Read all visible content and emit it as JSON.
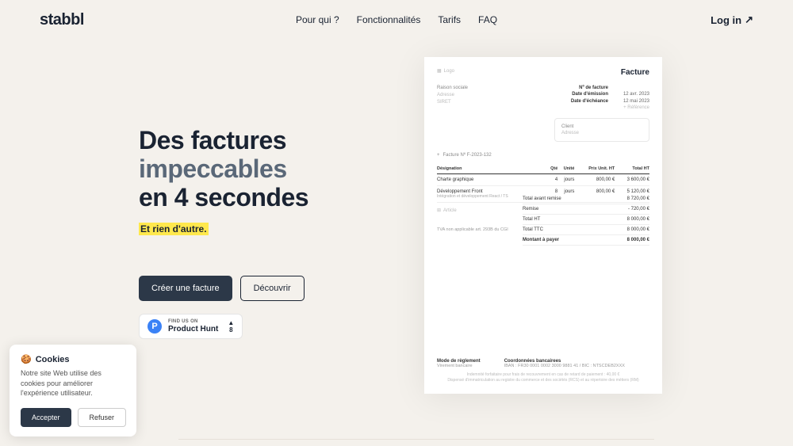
{
  "header": {
    "logo": "stabbl",
    "nav": [
      "Pour qui ?",
      "Fonctionnalités",
      "Tarifs",
      "FAQ"
    ],
    "login": "Log in",
    "login_icon": "↗"
  },
  "hero": {
    "line1": "Des factures",
    "line2": "impeccables",
    "line3": "en 4 secondes",
    "tagline": "Et rien d'autre.",
    "cta_primary": "Créer une facture",
    "cta_secondary": "Découvrir"
  },
  "ph": {
    "small": "FIND US ON",
    "big": "Product Hunt",
    "icon_letter": "P",
    "votes": "8"
  },
  "invoice": {
    "logo_label": "Logo",
    "title": "Facture",
    "company": {
      "name": "Raison sociale",
      "address": "Adresse",
      "siret": "SIRET"
    },
    "dates": {
      "num_label": "Nº de facture",
      "emission_label": "Date d'émission",
      "emission_val": "12 avr. 2023",
      "due_label": "Date d'échéance",
      "due_val": "12 mai 2023",
      "ref": "+ Référence"
    },
    "client": {
      "name": "Client",
      "address": "Adresse"
    },
    "number": "Facture Nº F-2023-132",
    "cols": {
      "desc": "Désignation",
      "qty": "Qté",
      "unit": "Unité",
      "price": "Prix Unit. HT",
      "total": "Total HT"
    },
    "lines": [
      {
        "desc": "Charte graphique",
        "sub": "",
        "qty": "4",
        "unit": "jours",
        "price": "800,00 €",
        "total": "3 600,00 €"
      },
      {
        "desc": "Développement Front",
        "sub": "Intégration et développement React / TS",
        "qty": "8",
        "unit": "jours",
        "price": "800,00 €",
        "total": "5 120,00 €"
      }
    ],
    "add_line": "Article",
    "tva_note": "TVA non applicable art. 293B du CGI",
    "totals": [
      {
        "label": "Total avant remise",
        "val": "8 720,00 €"
      },
      {
        "label": "Remise",
        "val": "- 720,00 €"
      },
      {
        "label": "Total HT",
        "val": "8 000,00 €"
      },
      {
        "label": "Total TTC",
        "val": "8 000,00 €"
      },
      {
        "label": "Montant à payer",
        "val": "8 000,00 €",
        "bold": true
      }
    ],
    "footer": {
      "pay_mode_label": "Mode de règlement",
      "pay_mode_val": "Virement bancaire",
      "bank_label": "Coordonnées bancairees",
      "bank_val": "IBAN : FR30 0001 0002 3000 9881 41 / BIC : NTSCDEB2XXX",
      "small1": "Indemnité forfaitaire pour frais de recouvrement en cas de retard de paiement : 40,00 €",
      "small2": "Dispensé d'immatriculation au registre du commerce et des sociétés (RCS) et au répertoire des métiers (RM)"
    }
  },
  "cookie": {
    "title": "Cookies",
    "emoji": "🍪",
    "text": "Notre site Web utilise des cookies pour améliorer l'expérience utilisateur.",
    "accept": "Accepter",
    "refuse": "Refuser"
  }
}
